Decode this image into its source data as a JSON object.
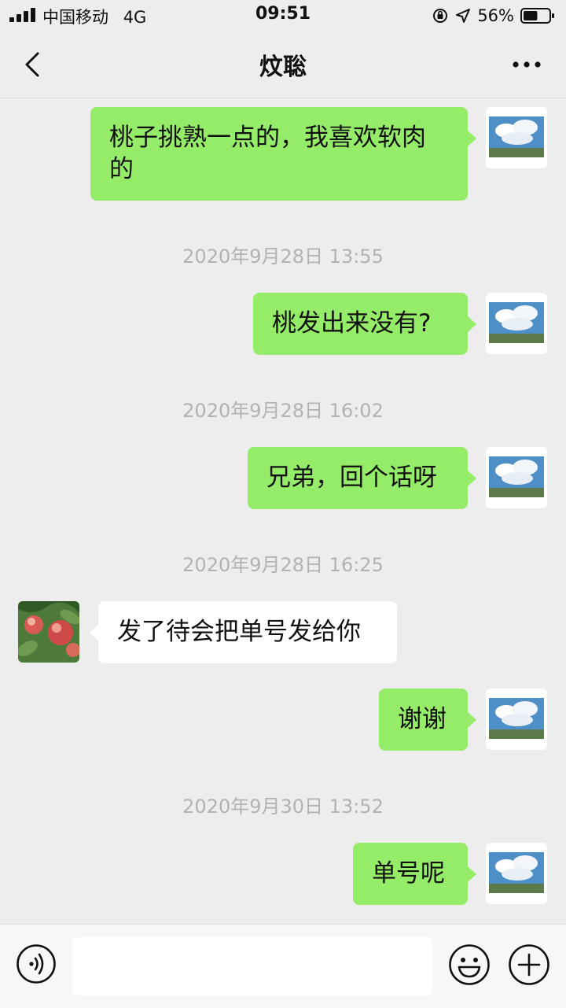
{
  "status_bar": {
    "carrier": "中国移动",
    "network": "4G",
    "time": "09:51",
    "battery_percent": "56%",
    "battery_level": 0.56,
    "icons": [
      "signal-icon",
      "orientation-lock-icon",
      "location-icon",
      "battery-icon"
    ]
  },
  "header": {
    "title": "炆聡",
    "back_icon": "chevron-left-icon",
    "more_icon": "more-icon"
  },
  "messages": [
    {
      "from": "me",
      "text": "桃子挑熟一点的，我喜欢软肉的"
    },
    {
      "timestamp": "2020年9月28日 13:55"
    },
    {
      "from": "me",
      "text": "桃发出来没有?"
    },
    {
      "timestamp": "2020年9月28日 16:02"
    },
    {
      "from": "me",
      "text": "兄弟，回个话呀"
    },
    {
      "timestamp": "2020年9月28日 16:25"
    },
    {
      "from": "them",
      "text": "发了待会把单号发给你"
    },
    {
      "from": "me",
      "text": "谢谢"
    },
    {
      "timestamp": "2020年9月30日 13:52"
    },
    {
      "from": "me",
      "text": "单号呢"
    }
  ],
  "input_bar": {
    "voice_icon": "voice-icon",
    "emoji_icon": "emoji-icon",
    "plus_icon": "plus-icon",
    "value": ""
  },
  "colors": {
    "background": "#ededed",
    "my_bubble": "#95ec69",
    "their_bubble": "#ffffff",
    "timestamp_text": "#b2b2b2"
  }
}
